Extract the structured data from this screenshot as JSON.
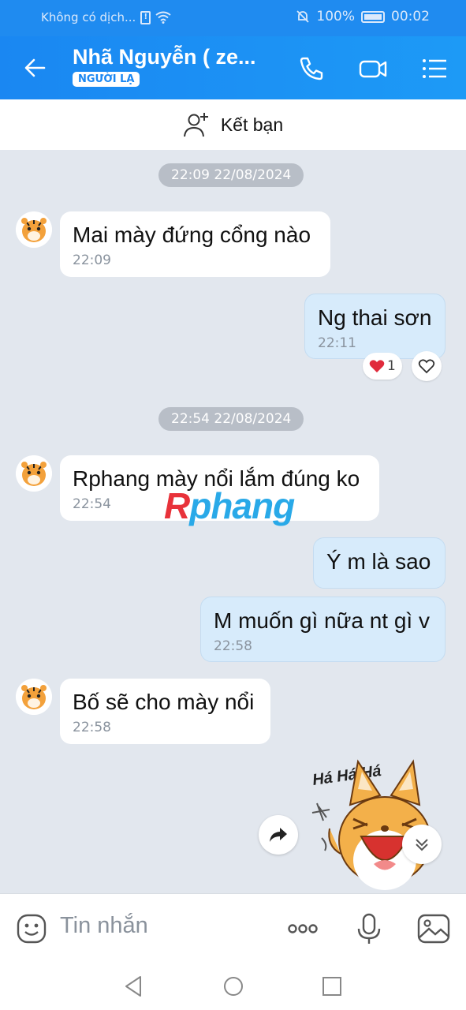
{
  "status_bar": {
    "carrier": "Không có dịch...",
    "battery": "100%",
    "time": "00:02"
  },
  "header": {
    "contact_name": "Nhã Nguyễn ( ze...",
    "badge": "NGƯỜI LẠ",
    "icons": [
      "back-arrow-icon",
      "phone-icon",
      "video-call-icon",
      "menu-list-icon"
    ]
  },
  "add_friend": {
    "label": "Kết bạn"
  },
  "messages": [
    {
      "type": "timestamp",
      "text": "22:09 22/08/2024"
    },
    {
      "type": "incoming",
      "text": "Mai mày đứng cổng nào",
      "time": "22:09"
    },
    {
      "type": "outgoing",
      "text": "Ng thai sơn",
      "time": "22:11",
      "reaction": {
        "emoji": "❤",
        "count": "1"
      }
    },
    {
      "type": "timestamp",
      "text": "22:54 22/08/2024"
    },
    {
      "type": "incoming",
      "text": "Rphang mày nổi lắm đúng ko",
      "time": "22:54"
    },
    {
      "type": "outgoing",
      "text": "Ý m là sao"
    },
    {
      "type": "outgoing",
      "text": "M muốn gì nữa nt gì v",
      "time": "22:58"
    },
    {
      "type": "incoming",
      "text": "Bố sẽ cho mày nổi",
      "time": "22:58"
    }
  ],
  "watermark": {
    "r": "R",
    "rest": "phang"
  },
  "sticker": {
    "caption": "Há Há Há"
  },
  "input": {
    "placeholder": "Tin nhắn"
  },
  "colors": {
    "header_blue": "#1a87f2",
    "outgoing_bubble": "#d7ebfb",
    "chat_bg": "#e2e7ee"
  }
}
